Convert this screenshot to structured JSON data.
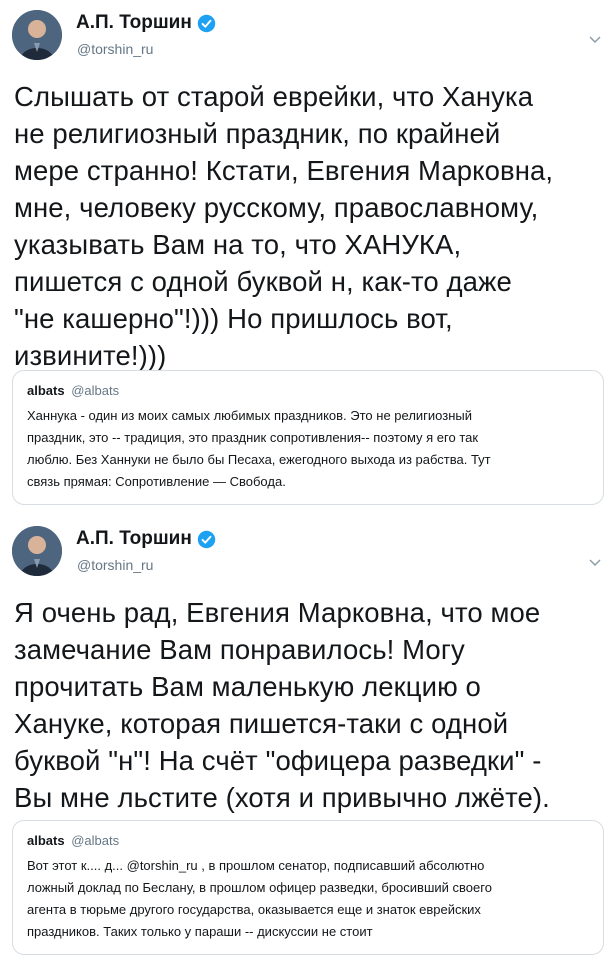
{
  "tweets": [
    {
      "author": {
        "name": "А.П. Торшин",
        "handle": "@torshin_ru"
      },
      "text": "Слышать от старой еврейки, что Ханука\nне религиозный праздник, по крайней\nмере странно! Кстати, Евгения Марковна,\nмне, человеку русскому, православному,\nуказывать Вам на то, что ХАНУКА,\nпишется с одной буквой н, как-то даже\n\"не кашерно\"!))) Но пришлось вот,\nизвините!)))",
      "quote": {
        "name": "albats",
        "handle": "@albats",
        "text": "Ханнука - один из моих самых любимых праздников. Это не религиозный\nпраздник, это -- традиция, это праздник сопротивления-- поэтому я его так\nлюблю. Без Ханнуки не было бы Песаха, ежегодного выхода из рабства. Тут\nсвязь прямая: Сопротивление — Свобода."
      }
    },
    {
      "author": {
        "name": "А.П. Торшин",
        "handle": "@torshin_ru"
      },
      "text": "Я очень рад, Евгения Марковна, что мое\nзамечание Вам понравилось! Могу\nпрочитать Вам маленькую лекцию о\nХануке, которая пишется-таки  с одной\nбуквой \"н\"! На счёт \"офицера разведки\" -\nВы мне льстите (хотя и привычно лжёте).",
      "quote": {
        "name": "albats",
        "handle": "@albats",
        "text": "Вот этот к.... д... @torshin_ru , в прошлом сенатор, подписавший абсолютно\nложный доклад по Беслану, в прошлом офицер разведки, бросивший своего\nагента в тюрьме другого государства, оказывается еще и знаток еврейских\nпраздников. Таких только у параши -- дискуссии не стоит"
      }
    }
  ],
  "icons": {
    "verified": "verified-badge-icon",
    "menu": "chevron-down-icon"
  },
  "colors": {
    "verified_blue": "#1da1f2",
    "secondary_text": "#657786",
    "border": "#d7dde2"
  }
}
